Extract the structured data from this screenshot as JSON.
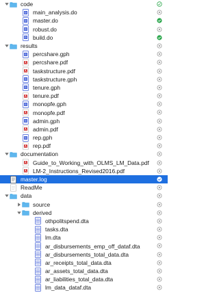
{
  "colors": {
    "accent": "#1e6fe0",
    "folder": "#5fb7ee",
    "pdf_red": "#d02a2a",
    "doc_blue": "#3d5bd6",
    "synced_green": "#2fa84f",
    "idle_gray": "#9a9a9a"
  },
  "rows": [
    {
      "label": "code",
      "type": "folder",
      "depth": 0,
      "disclosure": "open",
      "status": "synced-outline"
    },
    {
      "label": "main_analysis.do",
      "type": "do",
      "depth": 1,
      "status": "idle"
    },
    {
      "label": "master.do",
      "type": "do",
      "depth": 1,
      "status": "synced"
    },
    {
      "label": "robust.do",
      "type": "do",
      "depth": 1,
      "status": "idle"
    },
    {
      "label": "build.do",
      "type": "do",
      "depth": 1,
      "status": "synced"
    },
    {
      "label": "results",
      "type": "folder",
      "depth": 0,
      "disclosure": "open",
      "status": "idle"
    },
    {
      "label": "percshare.gph",
      "type": "gph",
      "depth": 1,
      "status": "idle"
    },
    {
      "label": "percshare.pdf",
      "type": "pdf",
      "depth": 1,
      "status": "idle"
    },
    {
      "label": "taskstructure.pdf",
      "type": "pdf",
      "depth": 1,
      "status": "idle"
    },
    {
      "label": "taskstructure.gph",
      "type": "gph",
      "depth": 1,
      "status": "idle"
    },
    {
      "label": "tenure.gph",
      "type": "gph",
      "depth": 1,
      "status": "idle"
    },
    {
      "label": "tenure.pdf",
      "type": "pdf",
      "depth": 1,
      "status": "idle"
    },
    {
      "label": "monopfe.gph",
      "type": "gph",
      "depth": 1,
      "status": "idle"
    },
    {
      "label": "monopfe.pdf",
      "type": "pdf",
      "depth": 1,
      "status": "idle"
    },
    {
      "label": "admin.gph",
      "type": "gph",
      "depth": 1,
      "status": "idle"
    },
    {
      "label": "admin.pdf",
      "type": "pdf",
      "depth": 1,
      "status": "idle"
    },
    {
      "label": "rep.gph",
      "type": "gph",
      "depth": 1,
      "status": "idle"
    },
    {
      "label": "rep.pdf",
      "type": "pdf",
      "depth": 1,
      "status": "idle"
    },
    {
      "label": "documentation",
      "type": "folder",
      "depth": 0,
      "disclosure": "open",
      "status": "idle"
    },
    {
      "label": "Guide_to_Working_with_OLMS_LM_Data.pdf",
      "type": "pdf",
      "depth": 1,
      "status": "idle"
    },
    {
      "label": "LM-2_Instructions_Revised2016.pdf",
      "type": "pdf",
      "depth": 1,
      "status": "idle"
    },
    {
      "label": "master.log",
      "type": "log",
      "depth": 0,
      "status": "synced",
      "selected": true
    },
    {
      "label": "ReadMe",
      "type": "text",
      "depth": 0,
      "status": "idle"
    },
    {
      "label": "data",
      "type": "folder",
      "depth": 0,
      "disclosure": "open",
      "status": "idle"
    },
    {
      "label": "source",
      "type": "folder",
      "depth": 1,
      "disclosure": "closed",
      "status": "idle"
    },
    {
      "label": "derived",
      "type": "folder",
      "depth": 1,
      "disclosure": "open",
      "status": "idle"
    },
    {
      "label": "othpolitspend.dta",
      "type": "dta",
      "depth": 2,
      "status": "idle"
    },
    {
      "label": "tasks.dta",
      "type": "dta",
      "depth": 2,
      "status": "idle"
    },
    {
      "label": "lm.dta",
      "type": "dta",
      "depth": 2,
      "status": "idle"
    },
    {
      "label": "ar_disbursements_emp_off_dataf.dta",
      "type": "dta",
      "depth": 2,
      "status": "idle"
    },
    {
      "label": "ar_disbursements_total_data.dta",
      "type": "dta",
      "depth": 2,
      "status": "idle"
    },
    {
      "label": "ar_receipts_total_data.dta",
      "type": "dta",
      "depth": 2,
      "status": "idle"
    },
    {
      "label": "ar_assets_total_data.dta",
      "type": "dta",
      "depth": 2,
      "status": "idle"
    },
    {
      "label": "ar_liabilities_total_data.dta",
      "type": "dta",
      "depth": 2,
      "status": "idle"
    },
    {
      "label": "lm_data_dataf.dta",
      "type": "dta",
      "depth": 2,
      "status": "idle"
    }
  ]
}
